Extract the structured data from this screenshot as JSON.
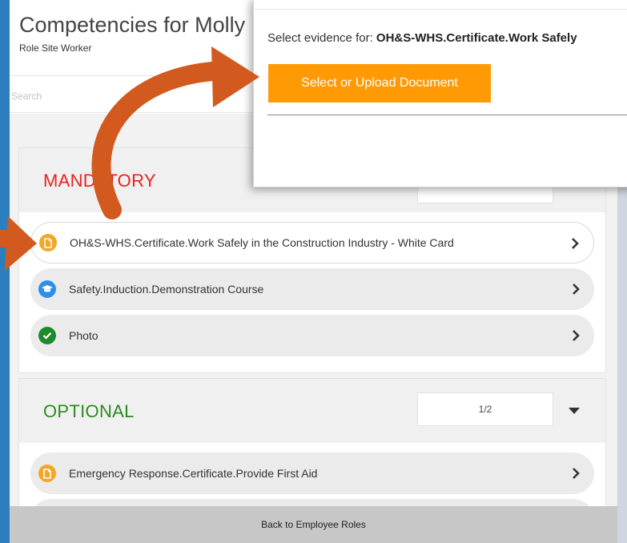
{
  "header": {
    "title": "Competencies for Molly",
    "subtitle": "Role Site Worker"
  },
  "search": {
    "placeholder": "Search"
  },
  "mandatory": {
    "label": "MANDATORY",
    "items": [
      {
        "label": "OH&S-WHS.Certificate.Work Safely in the Construction Industry - White Card",
        "icon": "document-icon",
        "color": "#f5a623"
      },
      {
        "label": "Safety.Induction.Demonstration Course",
        "icon": "graduation-cap-icon",
        "color": "#2f8fe8"
      },
      {
        "label": "Photo",
        "icon": "check-circle-icon",
        "color": "#1e8a2e"
      }
    ]
  },
  "optional": {
    "label": "OPTIONAL",
    "counter": "1/2",
    "items": [
      {
        "label": "Emergency Response.Certificate.Provide First Aid",
        "icon": "document-icon",
        "color": "#f5a623"
      }
    ]
  },
  "footer": {
    "back_label": "Back to Employee Roles"
  },
  "modal": {
    "prompt_prefix": "Select evidence for: ",
    "prompt_target": "OH&S-WHS.Certificate.Work Safely",
    "upload_label": "Select or Upload Document",
    "accent": "#ff9a05"
  },
  "annotation": {
    "arrow_color": "#d35a1f"
  }
}
